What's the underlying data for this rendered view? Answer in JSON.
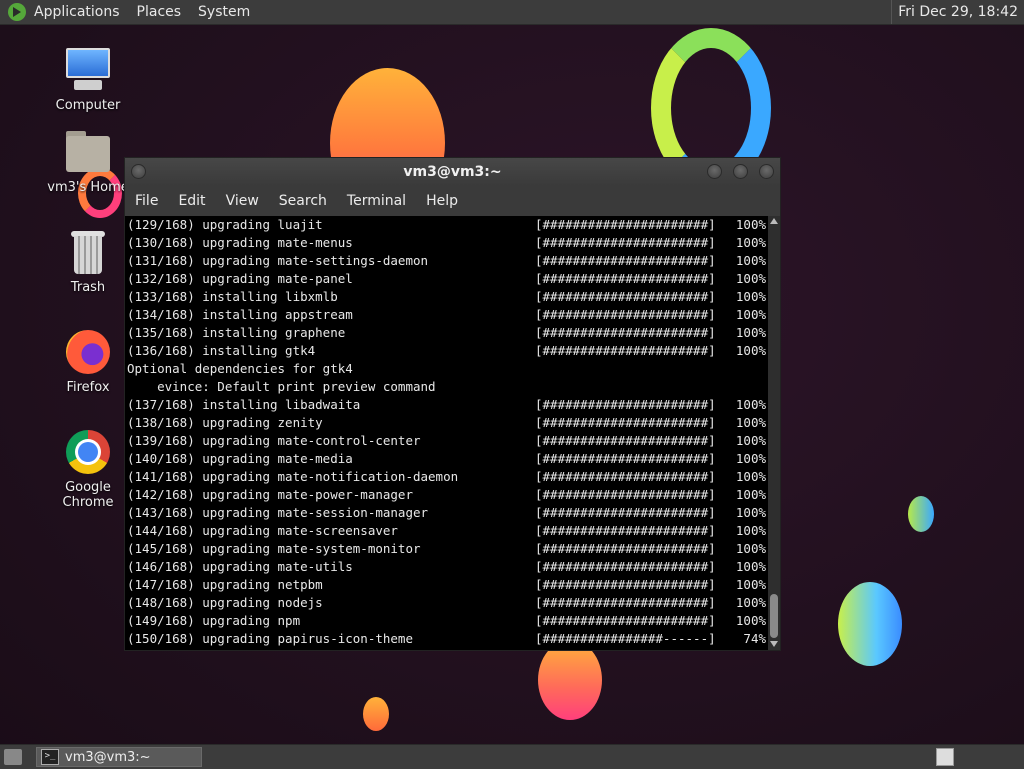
{
  "top_panel": {
    "menus": [
      "Applications",
      "Places",
      "System"
    ],
    "clock": "Fri Dec 29, 18:42"
  },
  "desktop_icons": [
    {
      "label": "Computer"
    },
    {
      "label": "vm3's Home"
    },
    {
      "label": "Trash"
    },
    {
      "label": "Firefox"
    },
    {
      "label": "Google Chrome"
    }
  ],
  "window": {
    "title": "vm3@vm3:~",
    "menu": [
      "File",
      "Edit",
      "View",
      "Search",
      "Terminal",
      "Help"
    ]
  },
  "terminal_lines": [
    {
      "text": "(129/168) upgrading luajit",
      "bar": "[######################]",
      "pct": "100%"
    },
    {
      "text": "(130/168) upgrading mate-menus",
      "bar": "[######################]",
      "pct": "100%"
    },
    {
      "text": "(131/168) upgrading mate-settings-daemon",
      "bar": "[######################]",
      "pct": "100%"
    },
    {
      "text": "(132/168) upgrading mate-panel",
      "bar": "[######################]",
      "pct": "100%"
    },
    {
      "text": "(133/168) installing libxmlb",
      "bar": "[######################]",
      "pct": "100%"
    },
    {
      "text": "(134/168) installing appstream",
      "bar": "[######################]",
      "pct": "100%"
    },
    {
      "text": "(135/168) installing graphene",
      "bar": "[######################]",
      "pct": "100%"
    },
    {
      "text": "(136/168) installing gtk4",
      "bar": "[######################]",
      "pct": "100%"
    },
    {
      "text": "Optional dependencies for gtk4",
      "bar": "",
      "pct": ""
    },
    {
      "text": "    evince: Default print preview command",
      "bar": "",
      "pct": ""
    },
    {
      "text": "(137/168) installing libadwaita",
      "bar": "[######################]",
      "pct": "100%"
    },
    {
      "text": "(138/168) upgrading zenity",
      "bar": "[######################]",
      "pct": "100%"
    },
    {
      "text": "(139/168) upgrading mate-control-center",
      "bar": "[######################]",
      "pct": "100%"
    },
    {
      "text": "(140/168) upgrading mate-media",
      "bar": "[######################]",
      "pct": "100%"
    },
    {
      "text": "(141/168) upgrading mate-notification-daemon",
      "bar": "[######################]",
      "pct": "100%"
    },
    {
      "text": "(142/168) upgrading mate-power-manager",
      "bar": "[######################]",
      "pct": "100%"
    },
    {
      "text": "(143/168) upgrading mate-session-manager",
      "bar": "[######################]",
      "pct": "100%"
    },
    {
      "text": "(144/168) upgrading mate-screensaver",
      "bar": "[######################]",
      "pct": "100%"
    },
    {
      "text": "(145/168) upgrading mate-system-monitor",
      "bar": "[######################]",
      "pct": "100%"
    },
    {
      "text": "(146/168) upgrading mate-utils",
      "bar": "[######################]",
      "pct": "100%"
    },
    {
      "text": "(147/168) upgrading netpbm",
      "bar": "[######################]",
      "pct": "100%"
    },
    {
      "text": "(148/168) upgrading nodejs",
      "bar": "[######################]",
      "pct": "100%"
    },
    {
      "text": "(149/168) upgrading npm",
      "bar": "[######################]",
      "pct": "100%"
    },
    {
      "text": "(150/168) upgrading papirus-icon-theme",
      "bar": "[################------]",
      "pct": "74%"
    }
  ],
  "taskbar": {
    "task_label": "vm3@vm3:~",
    "task_icon_glyph": ">_"
  },
  "icons": {
    "panel_logo": "mate-logo-icon",
    "computer": "computer-icon",
    "home": "home-folder-icon",
    "trash": "trash-icon",
    "firefox": "firefox-icon",
    "chrome": "chrome-icon",
    "terminal": "terminal-icon",
    "show_desktop": "show-desktop-icon",
    "workspace": "workspace-switcher-icon"
  }
}
